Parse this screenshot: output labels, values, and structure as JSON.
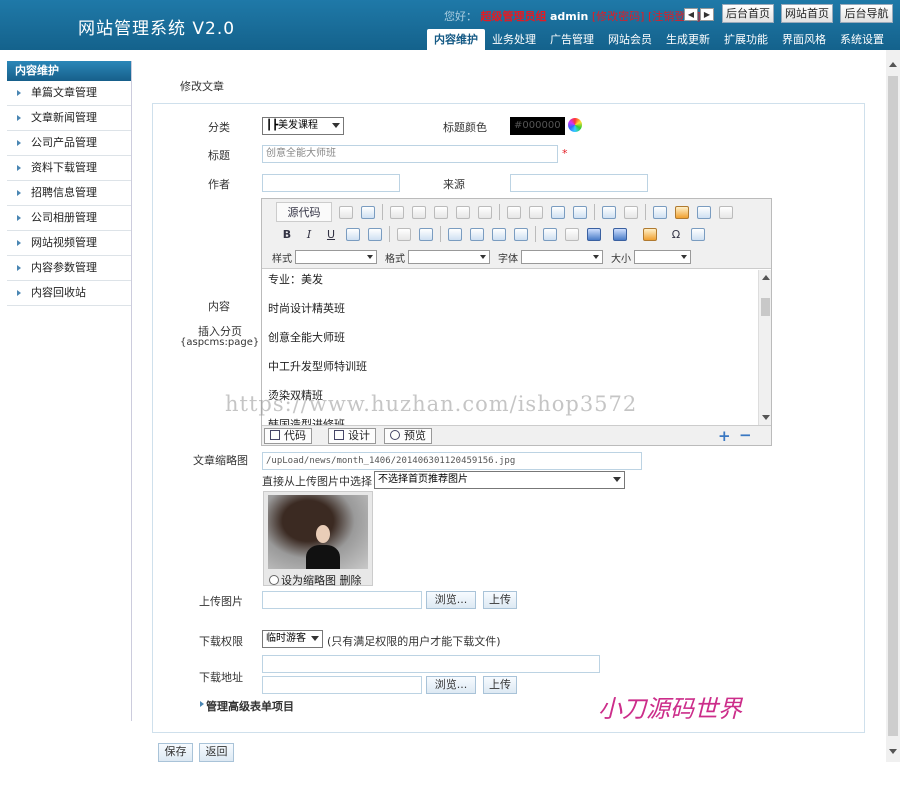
{
  "header": {
    "logo": "网站管理系统 V2.0",
    "greeting": "您好：",
    "role": "超级管理员组",
    "username": "admin",
    "logout": "[修改密码]  [注销登录]",
    "prev_label": "◀",
    "next_label": "▶",
    "btn_admin_home": "后台首页",
    "btn_site_home": "网站首页",
    "btn_admin_nav": "后台导航"
  },
  "nav": {
    "tabs": [
      "内容维护",
      "业务处理",
      "广告管理",
      "网站会员",
      "生成更新",
      "扩展功能",
      "界面风格",
      "系统设置"
    ],
    "active": "内容维护"
  },
  "sidebar": {
    "title": "内容维护",
    "items": [
      "单篇文章管理",
      "文章新闻管理",
      "公司产品管理",
      "资料下载管理",
      "招聘信息管理",
      "公司相册管理",
      "网站视频管理",
      "内容参数管理",
      "内容回收站"
    ]
  },
  "form": {
    "panel_title": "修改文章",
    "category_label": "分类",
    "category_value": "┃┣美发课程",
    "title_color_label": "标题颜色",
    "title_color_value": "#000000",
    "title_label": "标题",
    "title_value": "创意全能大师班",
    "required_mark": "*",
    "author_label": "作者",
    "author_value": "",
    "source_label": "来源",
    "source_value": "",
    "content_label": "内容",
    "page_break_label": "插入分页",
    "page_break_code": "{aspcms:page}",
    "thumb_label": "文章缩略图",
    "thumb_path": "/upLoad/news/month_1406/201406301120459156.jpg",
    "thumb_pick_label": "直接从上传图片中选择：",
    "thumb_pick_value": "不选择首页推荐图片",
    "thumb_set_label": "设为缩略图",
    "thumb_delete_label": "删除",
    "upload_label": "上传图片",
    "browse_label": "浏览...",
    "upload_button": "上传",
    "download_perm_label": "下载权限",
    "download_perm_value": "临时游客",
    "download_perm_note": "(只有满足权限的用户才能下载文件)",
    "download_url_label": "下载地址",
    "browse_label_2": "浏览...",
    "upload_button_2": "上传",
    "advanced_label": "管理高级表单项目",
    "save_button": "保存",
    "back_button": "返回"
  },
  "editor": {
    "source_label": "源代码",
    "bold": "B",
    "italic": "I",
    "underline": "U",
    "style_label": "样式",
    "format_label": "格式",
    "font_label": "字体",
    "size_label": "大小",
    "omega": "Ω",
    "paragraphs": [
      "专业：美发",
      "时尚设计精英班",
      "创意全能大师班",
      "中工升发型师特训班",
      "烫染双精班",
      "韩国造型进修班"
    ],
    "mode_code": "代码",
    "mode_design": "设计",
    "mode_preview": "预览",
    "expand": "+",
    "shrink": "−"
  },
  "watermarks": {
    "url": "https://www.huzhan.com/ishop3572",
    "brand": "小刀源码世界"
  },
  "colors": {
    "header_bg": "#1a6e9c",
    "required": "#e31b23",
    "brand_watermark": "#cc2d8a"
  }
}
